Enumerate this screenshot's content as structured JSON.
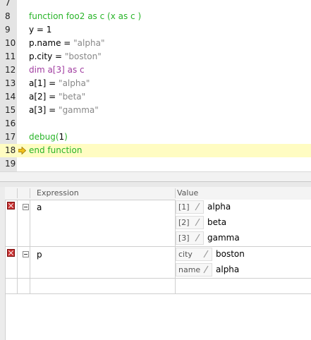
{
  "editor": {
    "lines": [
      {
        "num": "7",
        "parts": []
      },
      {
        "num": "8",
        "parts": [
          {
            "t": "function foo2 as c (x as c )",
            "c": "kw-green"
          }
        ]
      },
      {
        "num": "9",
        "parts": [
          {
            "t": "y = 1",
            "c": "plain"
          }
        ]
      },
      {
        "num": "10",
        "parts": [
          {
            "t": "p.name",
            "c": "plain"
          },
          {
            "t": " = ",
            "c": "plain"
          },
          {
            "t": "\"alpha\"",
            "c": "str"
          }
        ]
      },
      {
        "num": "11",
        "parts": [
          {
            "t": "p.city",
            "c": "plain"
          },
          {
            "t": " = ",
            "c": "plain"
          },
          {
            "t": "\"boston\"",
            "c": "str"
          }
        ]
      },
      {
        "num": "12",
        "parts": [
          {
            "t": "dim a[3] as c",
            "c": "kw-purple"
          }
        ]
      },
      {
        "num": "13",
        "parts": [
          {
            "t": "a[1]",
            "c": "plain"
          },
          {
            "t": " = ",
            "c": "plain"
          },
          {
            "t": "\"alpha\"",
            "c": "str"
          }
        ]
      },
      {
        "num": "14",
        "parts": [
          {
            "t": "a[2]",
            "c": "plain"
          },
          {
            "t": " = ",
            "c": "plain"
          },
          {
            "t": "\"beta\"",
            "c": "str"
          }
        ]
      },
      {
        "num": "15",
        "parts": [
          {
            "t": "a[3]",
            "c": "plain"
          },
          {
            "t": " = ",
            "c": "plain"
          },
          {
            "t": "\"gamma\"",
            "c": "str"
          }
        ]
      },
      {
        "num": "16",
        "parts": []
      },
      {
        "num": "17",
        "parts": [
          {
            "t": "debug(",
            "c": "kw-green"
          },
          {
            "t": "1",
            "c": "plain"
          },
          {
            "t": ")",
            "c": "kw-green"
          }
        ]
      },
      {
        "num": "18",
        "parts": [
          {
            "t": "end function",
            "c": "kw-green"
          }
        ],
        "current": true
      },
      {
        "num": "19",
        "parts": []
      }
    ]
  },
  "watch": {
    "headers": {
      "expression": "Expression",
      "value": "Value"
    },
    "items": [
      {
        "expression": "a",
        "children": [
          {
            "key": "[1]",
            "value": "alpha"
          },
          {
            "key": "[2]",
            "value": "beta"
          },
          {
            "key": "[3]",
            "value": "gamma"
          }
        ]
      },
      {
        "expression": "p",
        "children": [
          {
            "key": "city",
            "value": "boston"
          },
          {
            "key": "name",
            "value": "alpha"
          }
        ]
      }
    ]
  },
  "icons": {
    "current_line": "execution-arrow-icon",
    "remove": "remove-watch-icon",
    "collapse": "collapse-icon",
    "edit": "pencil-icon"
  },
  "colors": {
    "keyword": "#28b428",
    "dim_keyword": "#a03ca0",
    "string": "#888888",
    "current_line_bg": "#fffcc2",
    "remove_icon": "#c83030"
  }
}
